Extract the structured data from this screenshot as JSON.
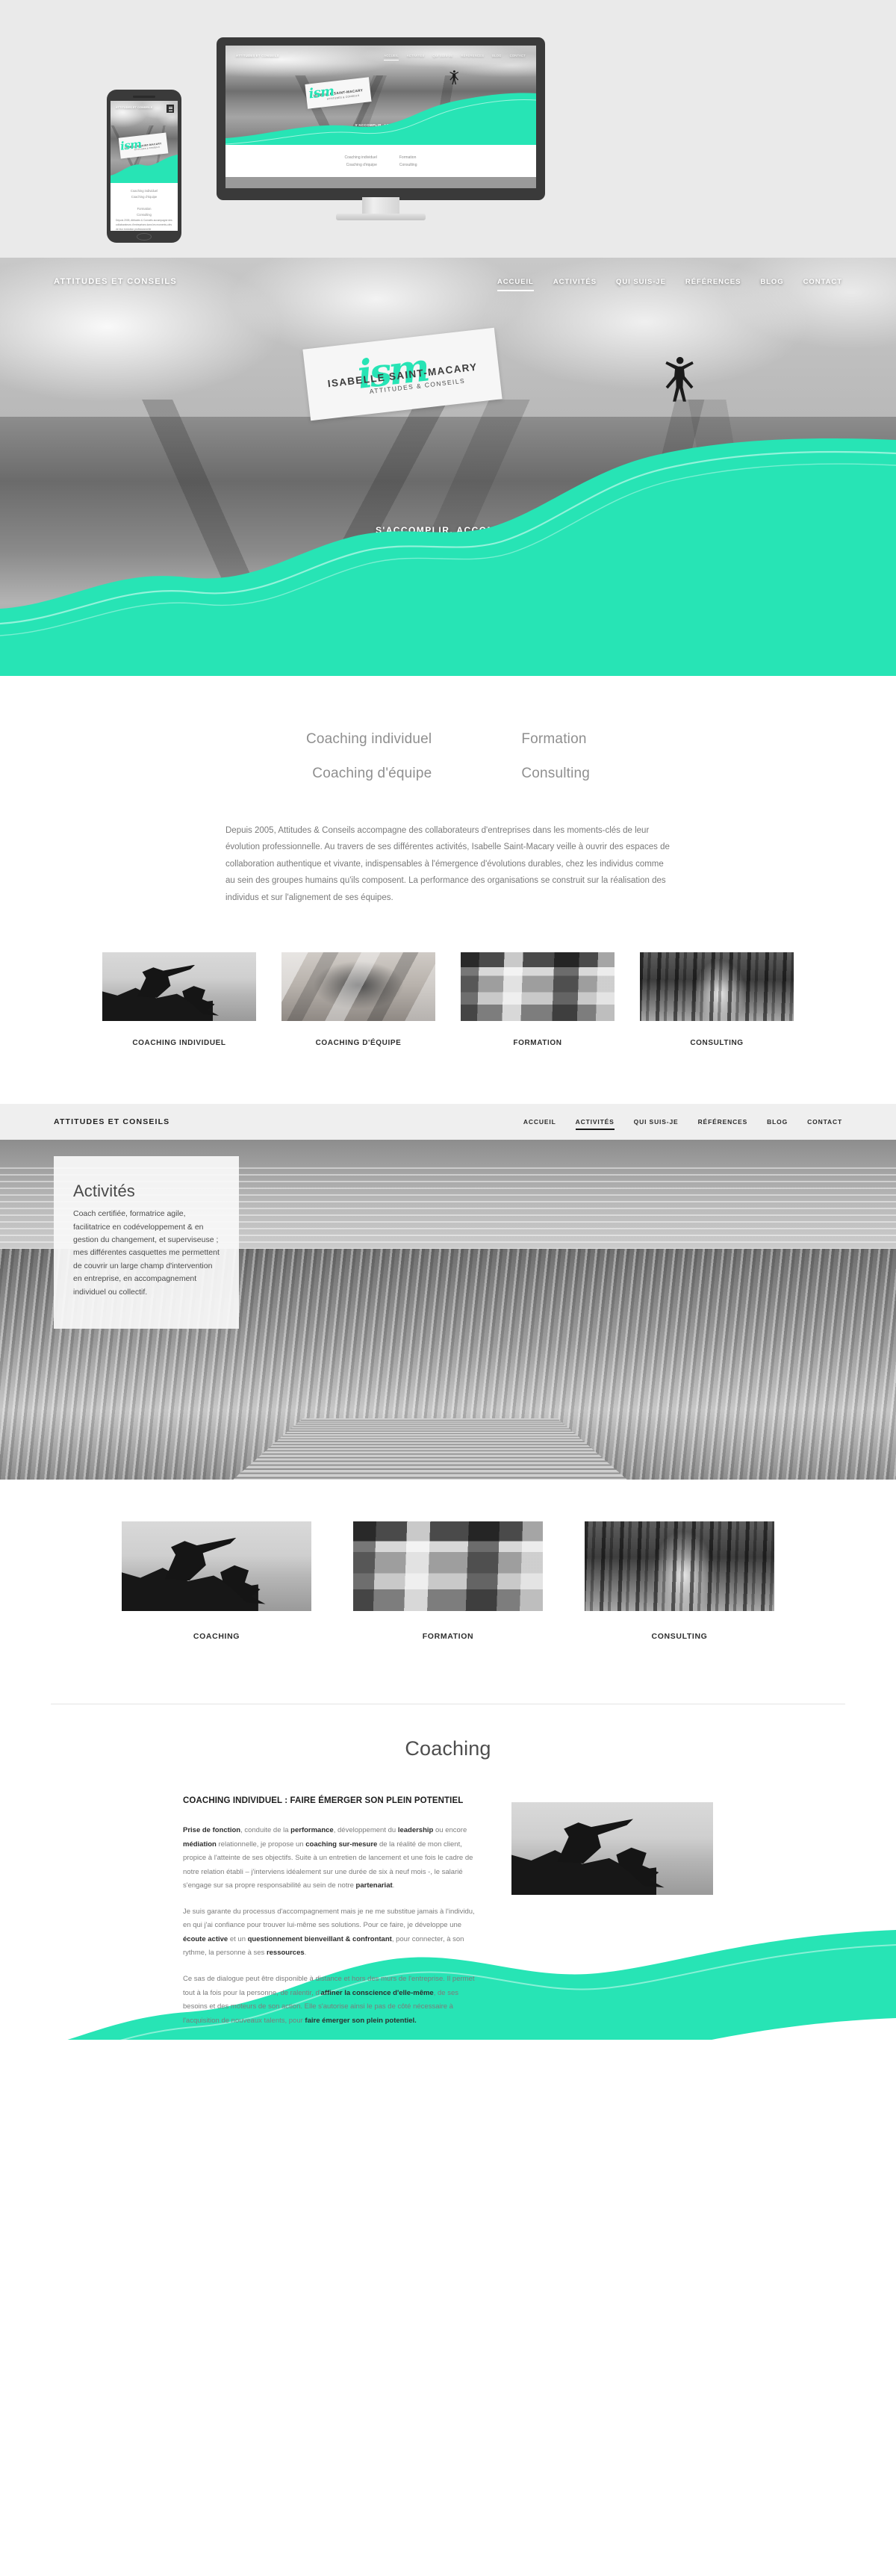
{
  "brand": {
    "name": "ATTITUDES ET CONSEILS",
    "logo_script": "ism",
    "logo_name": "ISABELLE SAINT-MACARY",
    "logo_sub": "ATTITUDES & CONSEILS",
    "accent_color": "#27e4b5",
    "tagline": "S'ACCOMPLIR, ACCOMPLIR"
  },
  "nav": {
    "items": [
      {
        "label": "ACCUEIL",
        "active": true
      },
      {
        "label": "ACTIVITÉS",
        "active": false
      },
      {
        "label": "QUI SUIS-JE",
        "active": false
      },
      {
        "label": "RÉFÉRENCES",
        "active": false
      },
      {
        "label": "BLOG",
        "active": false
      },
      {
        "label": "CONTACT",
        "active": false
      }
    ]
  },
  "nav_activites": {
    "items": [
      {
        "label": "ACCUEIL",
        "active": false
      },
      {
        "label": "ACTIVITÉS",
        "active": true
      },
      {
        "label": "QUI SUIS-JE",
        "active": false
      },
      {
        "label": "RÉFÉRENCES",
        "active": false
      },
      {
        "label": "BLOG",
        "active": false
      },
      {
        "label": "CONTACT",
        "active": false
      }
    ]
  },
  "services": {
    "left": [
      "Coaching individuel",
      "Coaching d'équipe"
    ],
    "right": [
      "Formation",
      "Consulting"
    ]
  },
  "intro": {
    "text": "Depuis 2005, Attitudes & Conseils accompagne des collaborateurs d'entreprises dans les moments-clés de leur évolution professionnelle. Au travers de ses différentes activités, Isabelle Saint-Macary veille à ouvrir des espaces de collaboration authentique et vivante, indispensables à l'émergence d'évolutions durables, chez les individus comme au sein des groupes humains qu'ils composent. La performance des organisations se construit sur la réalisation des individus et sur l'alignement de ses équipes."
  },
  "intro_mobile": {
    "text": "Depuis 2005, Attitudes & Conseils accompagne des collaborateurs d'entreprises dans les moments-clés de leur évolution professionnelle"
  },
  "cards4": [
    {
      "caption": "COACHING INDIVIDUEL",
      "image": "climbers-helping-hand-photo"
    },
    {
      "caption": "COACHING D'ÉQUIPE",
      "image": "stacked-hands-team-photo"
    },
    {
      "caption": "FORMATION",
      "image": "workshop-table-photo"
    },
    {
      "caption": "CONSULTING",
      "image": "forest-path-walker-photo"
    }
  ],
  "activites": {
    "title": "Activités",
    "body": "Coach certifiée, formatrice agile, facilitatrice en codéveloppement & en gestion du changement, et superviseuse ; mes différentes casquettes me permettent de couvrir un large champ d'intervention en entreprise, en accompagnement individuel ou collectif."
  },
  "cards3": [
    {
      "caption": "COACHING",
      "image": "climbers-helping-hand-photo"
    },
    {
      "caption": "FORMATION",
      "image": "workshop-table-photo"
    },
    {
      "caption": "CONSULTING",
      "image": "forest-path-walker-photo"
    }
  ],
  "coaching": {
    "title": "Coaching",
    "heading": "COACHING INDIVIDUEL : FAIRE ÉMERGER SON PLEIN POTENTIEL",
    "paragraph1_html": "<b>Prise de fonction</b>, conduite de la <b>performance</b>, développement du <b>leadership</b> ou encore <b>médiation</b> relationnelle, je propose un <b>coaching sur-mesure</b> de la réalité de mon client, propice à l'atteinte de ses objectifs. Suite à un entretien de lancement et une fois le cadre de notre relation établi – j'interviens idéalement sur une durée de six à neuf mois -, le salarié s'engage sur sa propre responsabilité au sein de notre <b>partenariat</b>.",
    "paragraph2_html": "Je suis garante du processus d'accompagnement mais je ne me substitue jamais à l'individu, en qui j'ai confiance pour trouver lui-même ses solutions. Pour ce faire, je développe une <b>écoute active</b> et un <b>questionnement bienveillant &amp; confrontant</b>, pour connecter, à son rythme, la personne à ses <b>ressources</b>.",
    "paragraph3_html": "Ce sas de dialogue peut être disponible à distance et hors des murs de l'entreprise. Il permet tout à la fois pour la personne, de ralentir, d'<b>affiner la conscience d'elle-même</b>, de ses besoins et des moteurs de son action. Elle s'autorise ainsi le pas de côté nécessaire à l'acquisition de nouveaux talents, pour <b>faire émerger son plein potentiel.</b>",
    "photo": "climbers-helping-hand-photo"
  }
}
